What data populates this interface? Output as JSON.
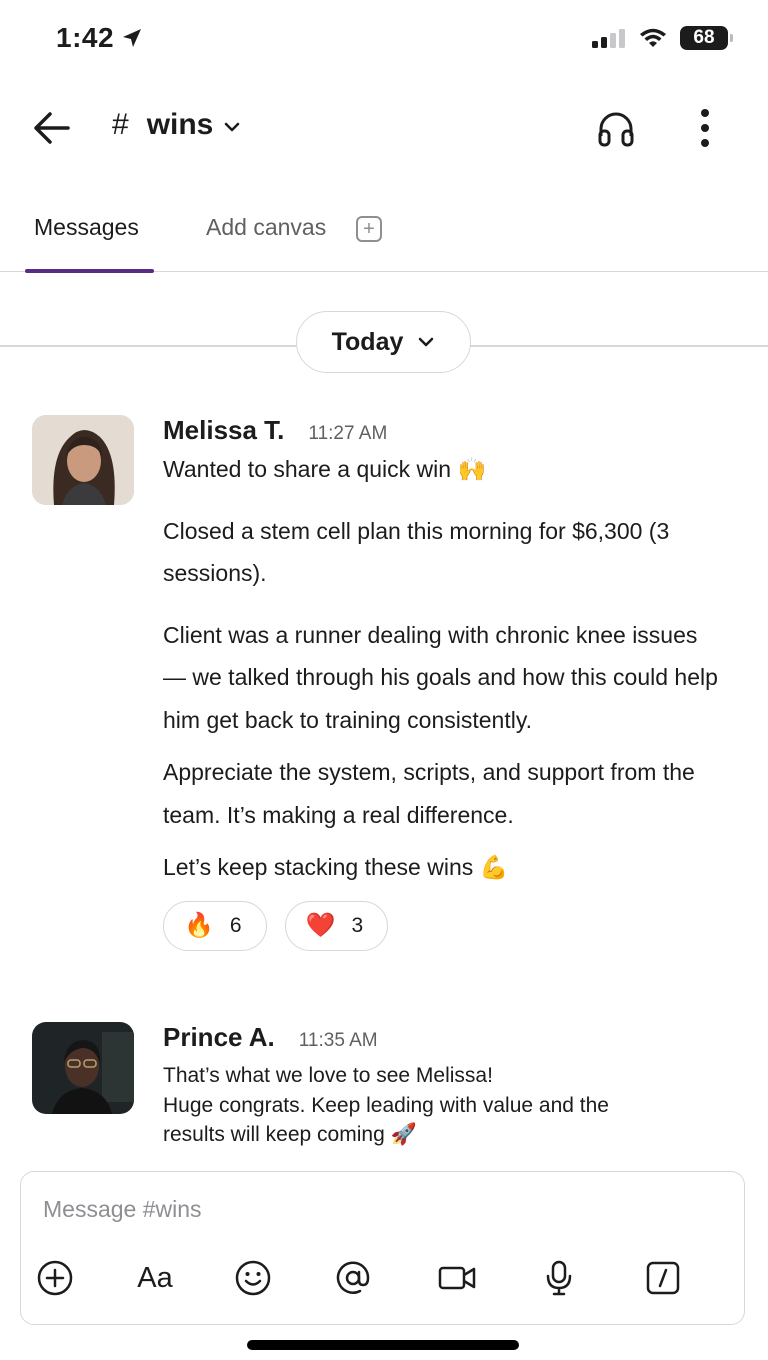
{
  "status_bar": {
    "time": "1:42",
    "battery": "68"
  },
  "header": {
    "channel_hash": "#",
    "channel_name": "wins"
  },
  "tabs": {
    "messages": "Messages",
    "add_canvas": "Add canvas"
  },
  "date_divider": {
    "label": "Today"
  },
  "messages": [
    {
      "author": "Melissa T.",
      "time": "11:27 AM",
      "paragraphs": [
        "Wanted to share a quick win 🙌",
        "Closed a stem cell plan this morning for $6,300 (3 sessions).",
        "Client was a runner dealing with chronic knee issues — we talked through his goals and how this could help him get back to training consistently.",
        "Appreciate the system, scripts, and support from the team. It’s making a real difference.",
        "Let’s keep stacking these wins 💪"
      ],
      "reactions": [
        {
          "emoji": "🔥",
          "count": "6"
        },
        {
          "emoji": "❤️",
          "count": "3"
        }
      ]
    },
    {
      "author": "Prince A.",
      "time": "11:35 AM",
      "lines": [
        "That’s what we love to see Melissa!",
        "Huge congrats. Keep leading with value and the",
        "results will keep coming 🚀"
      ]
    }
  ],
  "composer": {
    "placeholder": "Message #wins",
    "format_label": "Aa",
    "tools": [
      "plus-circle-icon",
      "text-format-icon",
      "emoji-icon",
      "mention-icon",
      "video-icon",
      "microphone-icon",
      "slash-command-icon"
    ]
  },
  "colors": {
    "accent": "#5b2a86",
    "divider": "#d8d8dc",
    "muted": "#616061"
  }
}
